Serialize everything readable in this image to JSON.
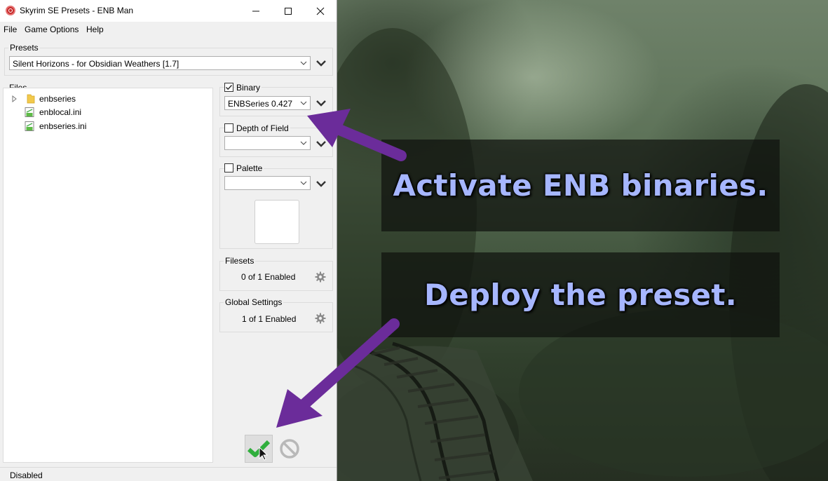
{
  "window": {
    "title": "Skyrim SE Presets - ENB Man",
    "controls": {
      "minimize": "—",
      "maximize": "☐",
      "close": "✕"
    }
  },
  "menu": [
    "File",
    "Game Options",
    "Help"
  ],
  "presets": {
    "label": "Presets",
    "selected": "Silent Horizons - for Obsidian Weathers [1.7]"
  },
  "files": {
    "label": "Files",
    "items": [
      {
        "name": "enbseries",
        "icon": "folder-icon",
        "expandable": true
      },
      {
        "name": "enblocal.ini",
        "icon": "ini-file-icon"
      },
      {
        "name": "enbseries.ini",
        "icon": "ini-file-icon"
      }
    ]
  },
  "binary": {
    "label": "Binary",
    "checked": true,
    "selected": "ENBSeries 0.427"
  },
  "depth_of_field": {
    "label": "Depth of Field",
    "checked": false,
    "selected": ""
  },
  "palette": {
    "label": "Palette",
    "checked": false,
    "selected": ""
  },
  "filesets": {
    "label": "Filesets",
    "status": "0 of 1 Enabled"
  },
  "global_settings": {
    "label": "Global Settings",
    "status": "1 of 1 Enabled"
  },
  "status_bar": {
    "text": "Disabled"
  },
  "banners": {
    "top": "Activate ENB binaries.",
    "bottom": "Deploy the preset."
  },
  "colors": {
    "banner_text": "#a6b6ff",
    "arrow": "#6b2c9a",
    "deploy_check": "#2fae3c"
  }
}
